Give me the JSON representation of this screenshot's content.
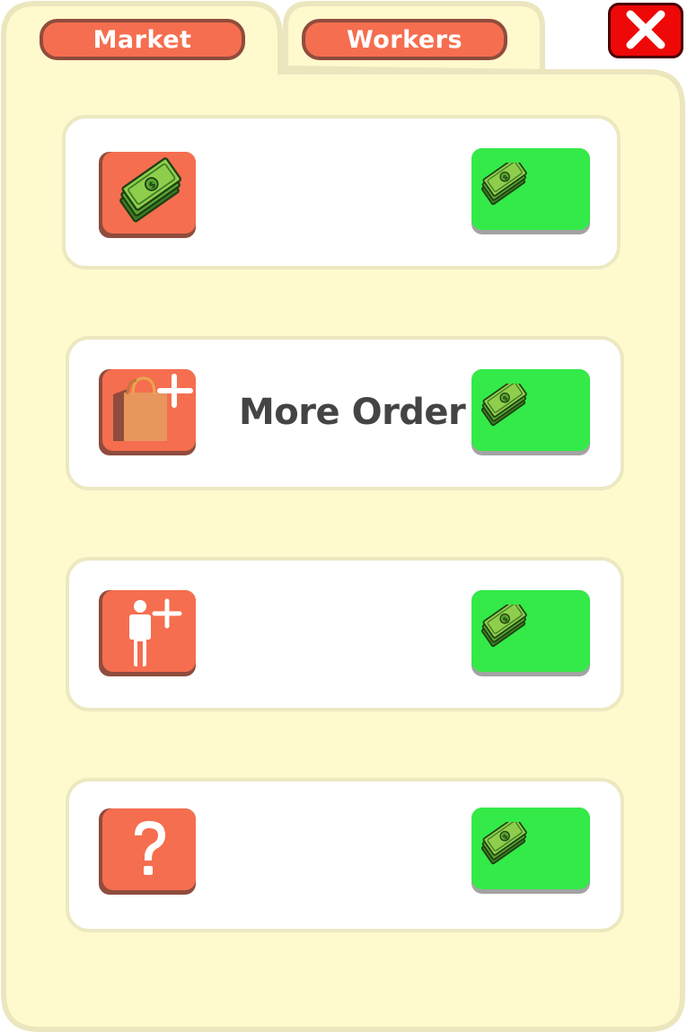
{
  "tabs": [
    {
      "label": "Market"
    },
    {
      "label": "Workers"
    }
  ],
  "items": [
    {
      "icon": "money-icon",
      "label": "",
      "buy_icon": "money-icon"
    },
    {
      "icon": "shopping-bag-plus-icon",
      "label": "More Order",
      "buy_icon": "money-icon"
    },
    {
      "icon": "add-worker-icon",
      "label": "",
      "buy_icon": "money-icon"
    },
    {
      "icon": "question-mark-icon",
      "label": "",
      "buy_icon": "money-icon"
    }
  ],
  "colors": {
    "panel": "#fffacd",
    "panel_border": "#ebe6be",
    "tab": "#f56e4f",
    "tab_border": "#8f4c3d",
    "buy_button": "#33ea48",
    "close_button": "#ee0808",
    "label_text": "#444444"
  }
}
